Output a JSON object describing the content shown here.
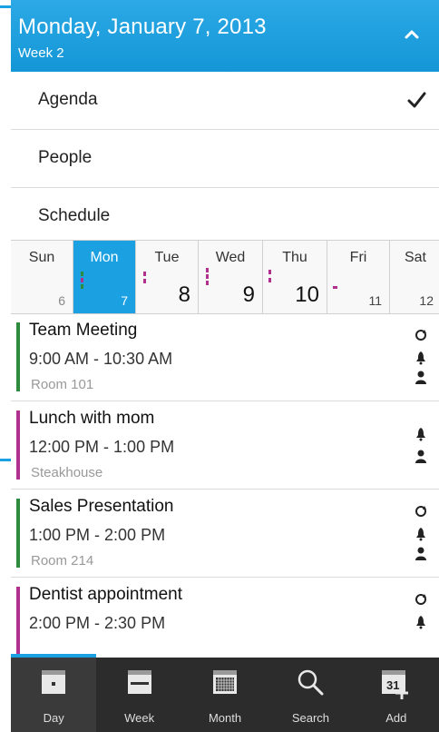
{
  "header": {
    "title": "Monday, January 7, 2013",
    "subtitle": "Week 2"
  },
  "menu": {
    "items": [
      {
        "label": "Agenda",
        "selected": true
      },
      {
        "label": "People",
        "selected": false
      },
      {
        "label": "Schedule",
        "selected": false
      }
    ]
  },
  "week": {
    "days": [
      {
        "name": "Sun",
        "date": "6"
      },
      {
        "name": "Mon",
        "date": "7",
        "selected": true
      },
      {
        "name": "Tue",
        "date": "8"
      },
      {
        "name": "Wed",
        "date": "9"
      },
      {
        "name": "Thu",
        "date": "10"
      },
      {
        "name": "Fri",
        "date": "11"
      },
      {
        "name": "Sat",
        "date": "12"
      }
    ]
  },
  "events": [
    {
      "title": "Team Meeting",
      "time": "9:00 AM - 10:30 AM",
      "location": "Room 101",
      "color": "#2e8b3d",
      "icons": [
        "recurring-icon",
        "bell-icon",
        "person-icon"
      ]
    },
    {
      "title": "Lunch with mom",
      "time": "12:00 PM - 1:00 PM",
      "location": "Steakhouse",
      "color": "#b0308e",
      "icons": [
        "bell-icon",
        "person-icon"
      ]
    },
    {
      "title": "Sales Presentation",
      "time": "1:00 PM - 2:00 PM",
      "location": "Room 214",
      "color": "#2e8b3d",
      "icons": [
        "recurring-icon",
        "bell-icon",
        "person-icon"
      ]
    },
    {
      "title": "Dentist appointment",
      "time": "2:00 PM - 2:30 PM",
      "location": "",
      "color": "#b0308e",
      "icons": [
        "recurring-icon",
        "bell-icon",
        "person-icon"
      ]
    }
  ],
  "toolbar": {
    "items": [
      {
        "label": "Day",
        "icon": "calendar-day-icon",
        "active": true
      },
      {
        "label": "Week",
        "icon": "calendar-week-icon"
      },
      {
        "label": "Month",
        "icon": "calendar-month-icon"
      },
      {
        "label": "Search",
        "icon": "search-icon"
      },
      {
        "label": "Add",
        "icon": "add-event-icon",
        "badge": "31"
      }
    ]
  },
  "colors": {
    "accent": "#1ba1e2",
    "green": "#2e8b3d",
    "magenta": "#b0308e",
    "toolbar": "#2c2c2c"
  }
}
